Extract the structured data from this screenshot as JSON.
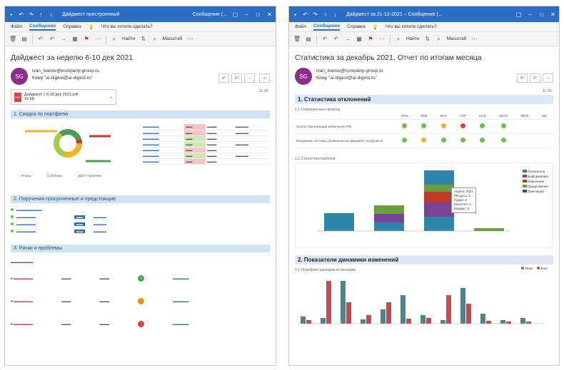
{
  "left": {
    "window_title": "Дайджест  пристроенный",
    "window_title_right": "Сообщение (...",
    "menu": [
      "Файл",
      "Сообщение",
      "Справка"
    ],
    "tell_me": "Что вы хотите сделать?",
    "toolbar_find": "Найти",
    "toolbar_zoom": "Масштаб",
    "subject": "Дайджест за неделю 6-10 дек 2021",
    "avatar": "SG",
    "from": "ivan_ivanov@company-group.ru",
    "to": "Кому  \"ai-digest@ai-digest.ru\"",
    "time": "11:06",
    "attachment_name": "Дайджест с 6-10 дек 2021.pdf",
    "attachment_size": "16 КБ",
    "sections": [
      "1. Сводка по портфелю",
      "2. Поручения просроченные и предстоящие",
      "3. Риски и проблемы"
    ],
    "kpi": [
      "Планы",
      "Субпланы",
      "ДЕЛ 7 проблем"
    ],
    "donut_colors": [
      "#f0b429",
      "#a8c94e",
      "#4e9c4e",
      "#c0392b"
    ]
  },
  "right": {
    "window_title": "Дайджест за 21-12-2021 – Сообщение (...",
    "menu": [
      "Файл",
      "Сообщение",
      "Справка"
    ],
    "tell_me": "Что вы хотите сделать?",
    "toolbar_find": "Найти",
    "toolbar_zoom": "Масштаб",
    "subject": "Статистика за декабрь 2021. Отчет по итогам месяца",
    "avatar": "SG",
    "from": "ivan_ivanov@company-group.ru",
    "to": "Кому  \"ai-digest@ai-digest.ru\"",
    "time": "11:06",
    "section1": "1. Статистика отклонений",
    "section2": "2. Показатели динамики изменений",
    "projects_label": "1.1 Сопроцентные проекты",
    "stat_cols": [
      "ЯНВ",
      "ФЕВ",
      "МАР",
      "АПР",
      "МАЙ",
      "ИЮН",
      "ИЮЛ",
      "АВГ"
    ],
    "stat_rows": [
      {
        "name": "Проект Организация мобильной УПК",
        "dots": [
          "#6bbf4a",
          "#6bbf4a",
          "#f0b429",
          "#d9413b",
          "#6bbf4a",
          "#6bbf4a",
          "",
          ""
        ]
      },
      {
        "name": "Внедрение системы управления мотивацией сотрудников",
        "dots": [
          "#6bbf4a",
          "#f0b429",
          "#6bbf4a",
          "#6bbf4a",
          "#6bbf4a",
          "#6bbf4a",
          "",
          ""
        ]
      }
    ],
    "chart1_label": "1.2 Статистика проблем",
    "chart2_label": "2.1 План/факт расходов по месяцам",
    "legend1": [
      "Показатели",
      "Информатика",
      "Изменения",
      "Предложения",
      "Замечания"
    ],
    "tooltip_title": "Апрель 2021",
    "tooltip_lines": [
      "Ресурсы: 2",
      "Сроки: 3",
      "Качество: 2",
      "Бюджет: 2"
    ],
    "legend2": [
      "План",
      "Факт"
    ]
  },
  "colors": {
    "accent": "#2b6cc4",
    "section": "#cfe2f3"
  }
}
